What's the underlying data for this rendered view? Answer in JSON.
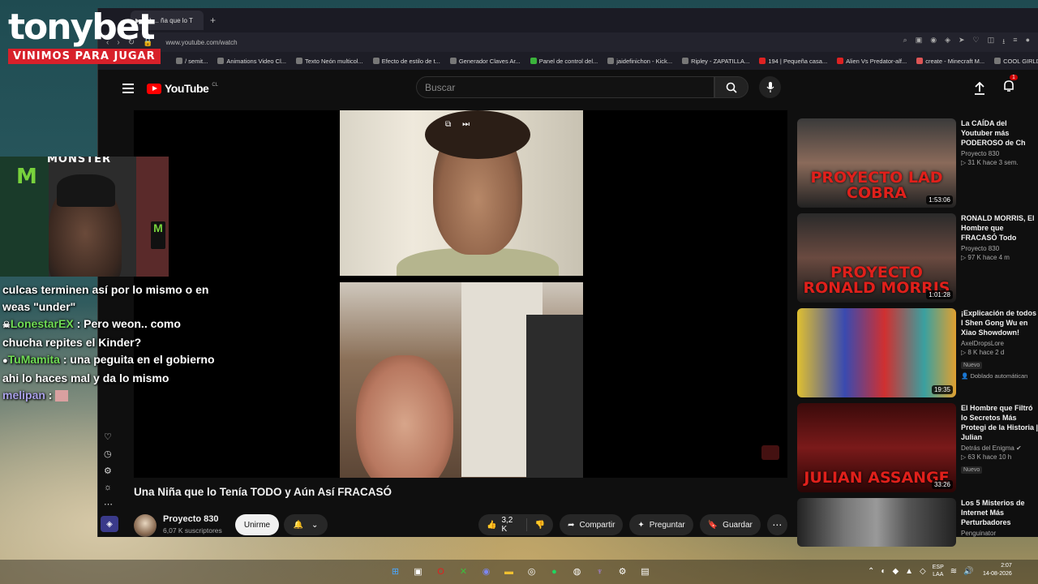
{
  "overlay": {
    "brand_name": "tonybet",
    "brand_tagline": "VINIMOS PARA JUGAR",
    "sponsor": "MONSTER"
  },
  "browser": {
    "tab_label": "(1) ... ña que lo T",
    "url": "www.youtube.com/watch",
    "bookmarks": [
      "/ semit...",
      "Animations Video Cl...",
      "Texto Neón multicol...",
      "Efecto de estilo de t...",
      "Generador Claves Ar...",
      "Panel de control del...",
      "jaidefinichon - Kick...",
      "Ripley - ZAPATILLA...",
      "194 | Pequeña casa...",
      "Alien Vs Predator-alf...",
      "create - Minecraft M...",
      "COOL GIRLD JAAJ |..."
    ]
  },
  "youtube": {
    "logo_text": "YouTube",
    "region": "CL",
    "search_placeholder": "Buscar",
    "notification_count": "1",
    "video": {
      "title": "Una Niña que lo Tenía TODO y Aún Así FRACASÓ",
      "channel": "Proyecto 830",
      "subscribers": "6,07 K suscriptores",
      "join_label": "Unirme",
      "likes": "3,2 K",
      "share_label": "Compartir",
      "ask_label": "Preguntar",
      "save_label": "Guardar"
    },
    "recommendations": [
      {
        "title": "La CAÍDA del Youtuber más PODEROSO de Ch",
        "channel": "Proyecto 830",
        "meta": "▷ 31 K  hace 3 sem.",
        "duration": "1:53:06",
        "caption": "PROYECTO LAD COBRA"
      },
      {
        "title": "RONALD MORRIS, El Hombre que FRACASÓ Todo",
        "channel": "Proyecto 830",
        "meta": "▷ 97 K  hace 4 m",
        "duration": "1:01:28",
        "caption": "PROYECTO RONALD MORRIS"
      },
      {
        "title": "¡Explicación de todos l Shen Gong Wu en Xiao Showdown!",
        "channel": "AxelDropsLore",
        "meta": "▷ 8 K  hace 2 d",
        "duration": "19:35",
        "badge": "Nuevo",
        "dub": "Doblado automátican"
      },
      {
        "title": "El Hombre que Filtró lo Secretos Más Protegi de la Historia | Julian",
        "channel": "Detrás del Enigma",
        "meta": "▷ 63 K  hace 10 h",
        "duration": "33:26",
        "badge": "Nuevo",
        "caption": "JULIAN ASSANGE"
      },
      {
        "title": "Los 5 Misterios de Internet Más Perturbadores",
        "channel": "Penguinator",
        "meta": "",
        "duration": ""
      }
    ]
  },
  "chat": [
    {
      "user": "",
      "message": "culcas terminen así por lo mismo o en weas \"under\""
    },
    {
      "user": "LonestarEX",
      "message": ": Pero weon.. como chucha repites el Kinder?"
    },
    {
      "user": "TuMamita",
      "message": ": una peguita en el gobierno ahi lo haces mal y da lo mismo"
    },
    {
      "user": "melipan",
      "message": ":"
    }
  ],
  "taskbar": {
    "lang_top": "ESP",
    "lang_bottom": "LAA",
    "time": "2:07",
    "date": "14-08-2026"
  },
  "colors": {
    "brand_red": "#d8202a",
    "youtube_red": "#ff0000",
    "chat_green": "#6fdc54",
    "chat_purple": "#a9a0e8"
  }
}
